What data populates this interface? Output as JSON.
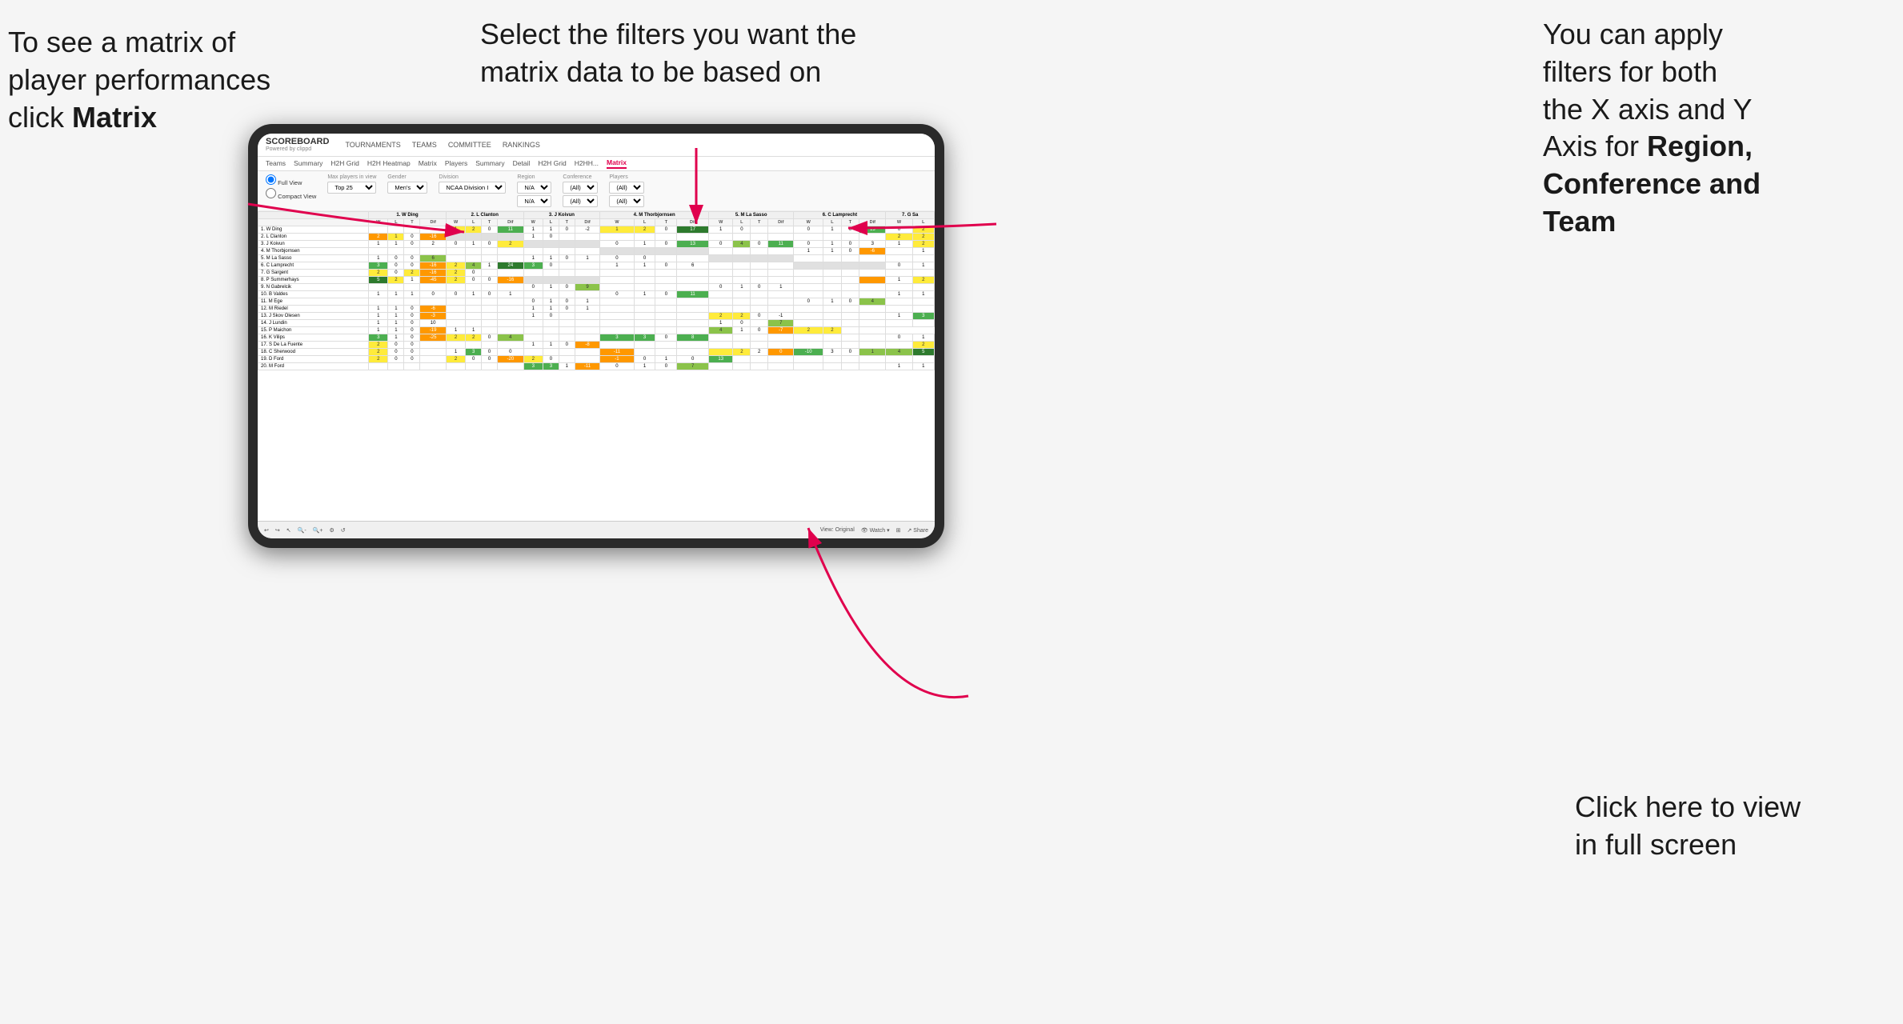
{
  "annotations": {
    "topleft": {
      "line1": "To see a matrix of",
      "line2": "player performances",
      "line3_normal": "click ",
      "line3_bold": "Matrix"
    },
    "topmid": {
      "text": "Select the filters you want the matrix data to be based on"
    },
    "topright": {
      "line1": "You  can apply",
      "line2": "filters for both",
      "line3": "the X axis and Y",
      "line4_normal": "Axis for ",
      "line4_bold": "Region,",
      "line5": "Conference and",
      "line6": "Team"
    },
    "bottomright": {
      "line1": "Click here to view",
      "line2": "in full screen"
    }
  },
  "app": {
    "logo": "SCOREBOARD",
    "powered": "Powered by clippd",
    "nav": [
      "TOURNAMENTS",
      "TEAMS",
      "COMMITTEE",
      "RANKINGS"
    ],
    "subnav": [
      "Teams",
      "Summary",
      "H2H Grid",
      "H2H Heatmap",
      "Matrix",
      "Players",
      "Summary",
      "Detail",
      "H2H Grid",
      "H2HH...",
      "Matrix"
    ],
    "active_tab": "Matrix"
  },
  "filters": {
    "view_options": [
      "Full View",
      "Compact View"
    ],
    "max_players": {
      "label": "Max players in view",
      "value": "Top 25"
    },
    "gender": {
      "label": "Gender",
      "value": "Men's"
    },
    "division": {
      "label": "Division",
      "value": "NCAA Division I"
    },
    "region": {
      "label": "Region",
      "values": [
        "N/A",
        "N/A"
      ]
    },
    "conference": {
      "label": "Conference",
      "values": [
        "(All)",
        "(All)"
      ]
    },
    "players": {
      "label": "Players",
      "values": [
        "(All)",
        "(All)"
      ]
    }
  },
  "matrix": {
    "col_headers": [
      "1. W Ding",
      "2. L Clanton",
      "3. J Koivun",
      "4. M Thorbjornsen",
      "5. M La Sasso",
      "6. C Lamprecht",
      "7. G Sa"
    ],
    "sub_cols": [
      "W",
      "L",
      "T",
      "Dif"
    ],
    "rows": [
      {
        "name": "1. W Ding",
        "cells": [
          "",
          "",
          "",
          "",
          "1",
          "2",
          "0",
          "11",
          "1",
          "1",
          "0",
          "-2",
          "1",
          "2",
          "0",
          "17",
          "1",
          "0",
          "",
          "",
          "0",
          "1",
          "0",
          "13",
          "0",
          "2"
        ]
      },
      {
        "name": "2. L Clanton",
        "cells": [
          "2",
          "1",
          "0",
          "-16",
          "",
          "",
          "",
          "",
          "1",
          "0",
          "",
          "",
          "",
          "",
          "",
          "",
          "",
          "",
          "",
          "",
          "",
          "",
          "",
          "",
          "2",
          "2"
        ]
      },
      {
        "name": "3. J Koivun",
        "cells": [
          "1",
          "1",
          "0",
          "2",
          "0",
          "1",
          "0",
          "2",
          "",
          "",
          "",
          "",
          "0",
          "1",
          "0",
          "13",
          "0",
          "4",
          "0",
          "11",
          "0",
          "1",
          "0",
          "3",
          "1",
          "2"
        ]
      },
      {
        "name": "4. M Thorbjornsen",
        "cells": [
          "",
          "",
          "",
          "",
          "",
          "",
          "",
          "",
          "",
          "",
          "",
          "",
          "",
          "",
          "",
          "",
          "",
          "",
          "",
          "",
          "1",
          "1",
          "0",
          "-6",
          "",
          "1"
        ]
      },
      {
        "name": "5. M La Sasso",
        "cells": [
          "1",
          "0",
          "0",
          "6",
          "",
          "",
          "",
          "",
          "1",
          "1",
          "0",
          "1",
          "0",
          "0",
          "",
          "",
          "",
          "",
          "",
          "",
          "",
          "",
          "",
          "",
          "",
          ""
        ]
      },
      {
        "name": "6. C Lamprecht",
        "cells": [
          "3",
          "0",
          "0",
          "-16",
          "2",
          "4",
          "1",
          "24",
          "3",
          "0",
          "",
          "",
          "1",
          "1",
          "0",
          "6",
          "",
          "",
          "",
          "",
          "",
          "",
          "",
          "",
          "0",
          "1"
        ]
      },
      {
        "name": "7. G Sargent",
        "cells": [
          "2",
          "0",
          "2",
          "-16",
          "2",
          "0",
          "",
          "",
          "",
          "",
          "",
          "",
          "",
          "",
          "",
          "",
          "",
          "",
          "",
          "",
          "",
          "",
          "",
          "",
          "",
          ""
        ]
      },
      {
        "name": "8. P Summerhays",
        "cells": [
          "5",
          "2",
          "1",
          "-45",
          "2",
          "0",
          "0",
          "-16",
          "",
          "",
          "",
          "",
          "",
          "",
          "",
          "",
          "",
          "",
          "",
          "",
          "",
          "",
          "",
          "",
          "1",
          "2"
        ]
      },
      {
        "name": "9. N Gabrelcik",
        "cells": [
          "",
          "",
          "",
          "",
          "",
          "",
          "",
          "",
          "0",
          "1",
          "0",
          "9",
          "",
          "",
          "",
          "",
          "0",
          "1",
          "0",
          "1",
          "",
          "",
          "",
          "",
          "",
          ""
        ]
      },
      {
        "name": "10. B Valdes",
        "cells": [
          "1",
          "1",
          "1",
          "0",
          "0",
          "1",
          "0",
          "1",
          "",
          "",
          "",
          "",
          "0",
          "1",
          "0",
          "11",
          "",
          "",
          "",
          "",
          "",
          "",
          "",
          "",
          "1",
          "1"
        ]
      },
      {
        "name": "11. M Ege",
        "cells": [
          "",
          "",
          "",
          "",
          "",
          "",
          "",
          "",
          "0",
          "1",
          "0",
          "1",
          "",
          "",
          "",
          "",
          "",
          "",
          "",
          "",
          "0",
          "1",
          "0",
          "4",
          "",
          ""
        ]
      },
      {
        "name": "12. M Riedel",
        "cells": [
          "1",
          "1",
          "0",
          "-6",
          "",
          "",
          "",
          "",
          "1",
          "1",
          "0",
          "1",
          "",
          "",
          "",
          "",
          "",
          "",
          "",
          "",
          "",
          "",
          "",
          "",
          "",
          ""
        ]
      },
      {
        "name": "13. J Skov Olesen",
        "cells": [
          "1",
          "1",
          "0",
          "-3",
          "",
          "",
          "",
          "",
          "1",
          "0",
          "",
          "",
          "",
          "",
          "",
          "",
          "2",
          "2",
          "0",
          "-1",
          "",
          "",
          "",
          "",
          "1",
          "3"
        ]
      },
      {
        "name": "14. J Lundin",
        "cells": [
          "1",
          "1",
          "0",
          "10",
          "",
          "",
          "",
          "",
          "",
          "",
          "",
          "",
          "",
          "",
          "",
          "",
          "1",
          "0",
          "",
          "7",
          "",
          "",
          "",
          "",
          "",
          ""
        ]
      },
      {
        "name": "15. P Maichon",
        "cells": [
          "1",
          "1",
          "0",
          "-19",
          "1",
          "1",
          "",
          "",
          "",
          "",
          "",
          "",
          "",
          "",
          "",
          "",
          "4",
          "1",
          "0",
          "-7",
          "2",
          "2",
          "",
          ""
        ]
      },
      {
        "name": "16. K Vilips",
        "cells": [
          "3",
          "1",
          "0",
          "-25",
          "2",
          "2",
          "0",
          "4",
          "",
          "",
          "",
          "",
          "3",
          "3",
          "0",
          "8",
          "",
          "",
          "",
          "",
          "",
          "",
          "",
          "",
          "0",
          "1"
        ]
      },
      {
        "name": "17. S De La Fuente",
        "cells": [
          "2",
          "0",
          "0",
          "",
          "",
          "",
          "",
          "",
          "1",
          "1",
          "0",
          "-8",
          "",
          "",
          "",
          "",
          "",
          "",
          "",
          "",
          "",
          "",
          "",
          "",
          "",
          "2"
        ]
      },
      {
        "name": "18. C Sherwood",
        "cells": [
          "2",
          "0",
          "0",
          "",
          "1",
          "3",
          "0",
          "0",
          "",
          "",
          "",
          "",
          "-11",
          "",
          "",
          "",
          "",
          "2",
          "2",
          "0",
          "-10",
          "3",
          "0",
          "1",
          "4",
          "5"
        ]
      },
      {
        "name": "19. D Ford",
        "cells": [
          "2",
          "0",
          "0",
          "",
          "2",
          "0",
          "0",
          "-20",
          "2",
          "0",
          "",
          "",
          "-1",
          "0",
          "1",
          "0",
          "13",
          "",
          "",
          "",
          "",
          "",
          "",
          "",
          "",
          ""
        ]
      },
      {
        "name": "20. M Ford",
        "cells": [
          "",
          "",
          "",
          "",
          "",
          "",
          "",
          "",
          "3",
          "3",
          "1",
          "-11",
          "0",
          "1",
          "0",
          "7",
          "",
          "",
          "",
          "",
          "",
          "",
          "",
          "",
          "1",
          "1"
        ]
      }
    ]
  },
  "toolbar": {
    "left_icons": [
      "undo",
      "redo",
      "pointer",
      "zoom-out",
      "zoom-in",
      "settings",
      "refresh"
    ],
    "view_label": "View: Original",
    "watch_label": "Watch",
    "share_label": "Share"
  }
}
